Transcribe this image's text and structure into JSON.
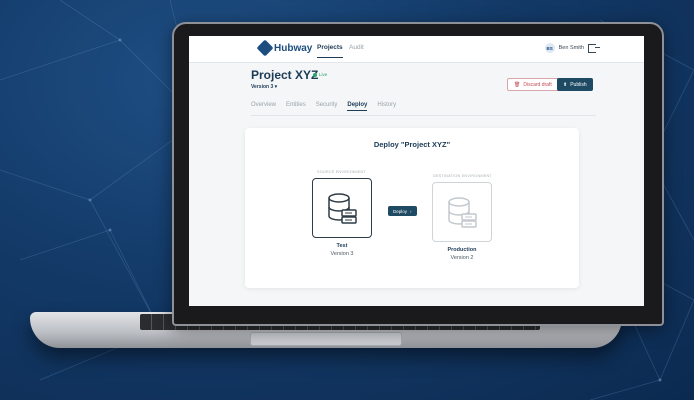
{
  "nav": {
    "logo_text": "Hubway",
    "tabs": [
      "Projects",
      "Audit"
    ],
    "user_initials": "BS",
    "user_name": "Ben Smith"
  },
  "project": {
    "title": "Project XYZ",
    "status": "Live",
    "version_selector": "Version 3"
  },
  "actions": {
    "discard_label": "Discard draft",
    "publish_label": "Publish"
  },
  "tabs": [
    "Overview",
    "Entities",
    "Security",
    "Deploy",
    "History"
  ],
  "deploy": {
    "title": "Deploy \"Project XYZ\"",
    "source_label": "SOURCE ENVIRONMENT",
    "source_name": "Test",
    "source_version": "Version 3",
    "destination_label": "DESTINATION ENVIRONMENT",
    "destination_name": "Production",
    "destination_version": "Version 2",
    "deploy_button": "Deploy"
  },
  "colors": {
    "primary": "#1e4a63",
    "live": "#2ea36b",
    "danger": "#c44b55",
    "background": "#133a68"
  }
}
